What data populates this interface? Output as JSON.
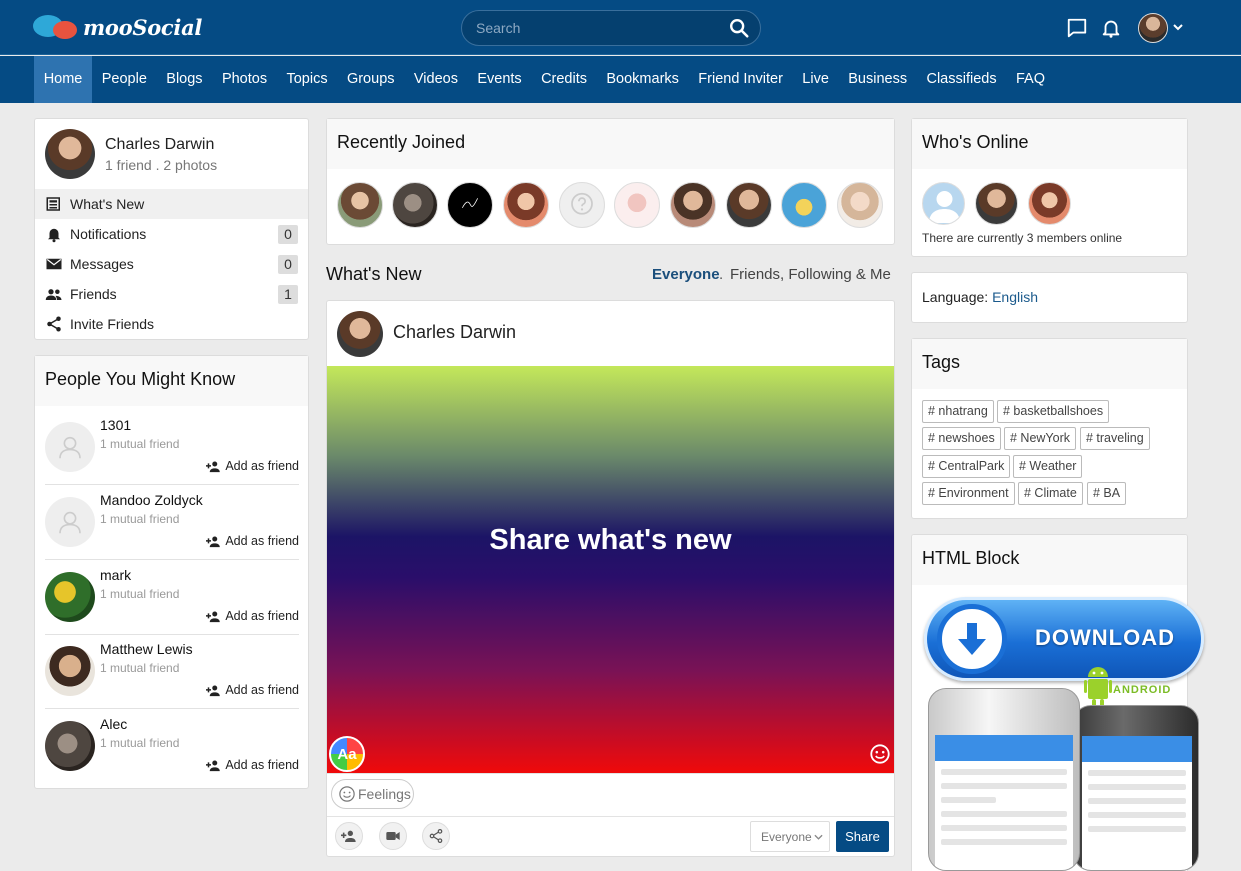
{
  "header": {
    "logo_text": "mooSocial",
    "search_placeholder": "Search",
    "icons": [
      "chat-bubble-icon",
      "bell-icon",
      "avatar",
      "chevron-down-icon"
    ]
  },
  "nav": {
    "items": [
      "Home",
      "People",
      "Blogs",
      "Photos",
      "Topics",
      "Groups",
      "Videos",
      "Events",
      "Credits",
      "Bookmarks",
      "Friend Inviter",
      "Live",
      "Business",
      "Classifieds",
      "FAQ"
    ],
    "active": "Home"
  },
  "profile": {
    "name": "Charles Darwin",
    "stats": "1 friend . 2 photos",
    "menu": [
      {
        "label": "What's New",
        "icon": "newspaper-icon",
        "count": null
      },
      {
        "label": "Notifications",
        "icon": "bell-icon",
        "count": "0"
      },
      {
        "label": "Messages",
        "icon": "envelope-icon",
        "count": "0"
      },
      {
        "label": "Friends",
        "icon": "people-icon",
        "count": "1"
      },
      {
        "label": "Invite Friends",
        "icon": "share-icon",
        "count": null
      }
    ]
  },
  "people_you_might_know": {
    "title": "People You Might Know",
    "add_label": "Add as friend",
    "people": [
      {
        "name": "1301",
        "mutual": "1 mutual friend"
      },
      {
        "name": "Mandoo Zoldyck",
        "mutual": "1 mutual friend"
      },
      {
        "name": "mark",
        "mutual": "1 mutual friend"
      },
      {
        "name": "Matthew Lewis",
        "mutual": "1 mutual friend"
      },
      {
        "name": "Alec",
        "mutual": "1 mutual friend"
      }
    ]
  },
  "recently_joined": {
    "title": "Recently Joined",
    "member_count_shown": 10
  },
  "whats_new": {
    "title": "What's New",
    "filter_everyone": "Everyone",
    "filter_separator": ".",
    "filter_friends": "Friends, Following & Me"
  },
  "composer": {
    "author": "Charles Darwin",
    "placeholder": "Share what's new",
    "aa_label": "Aa",
    "feelings_label": "Feelings",
    "privacy_value": "Everyone",
    "share_label": "Share",
    "gradient_colors": [
      "#c4e85a",
      "#1c1466",
      "#f00a0a"
    ]
  },
  "whos_online": {
    "title": "Who's Online",
    "summary": "There are currently 3 members online"
  },
  "language": {
    "label": "Language:",
    "value": "English"
  },
  "tags": {
    "title": "Tags",
    "items": [
      "# nhatrang",
      "# basketballshoes",
      "# newshoes",
      "# NewYork",
      "# traveling",
      "# CentralPark",
      "# Weather",
      "# Environment",
      "# Climate",
      "# BA"
    ]
  },
  "html_block": {
    "title": "HTML Block",
    "download_label": "DOWNLOAD",
    "android_label": "ANDROID"
  },
  "colors": {
    "brand": "#054b84",
    "nav_active": "#2e73b0",
    "link": "#1b5a8c"
  }
}
